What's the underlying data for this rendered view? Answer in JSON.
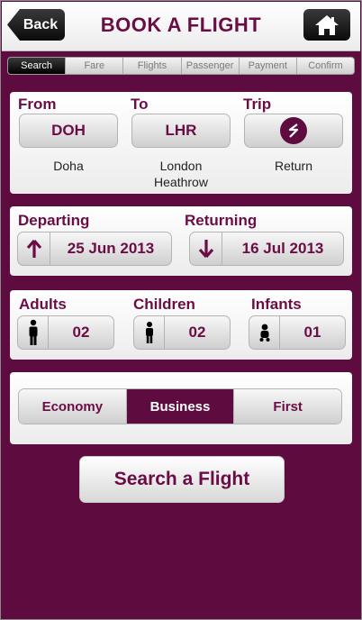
{
  "header": {
    "back_label": "Back",
    "title": "BOOK A FLIGHT",
    "home_icon": "home-icon"
  },
  "steps": [
    {
      "label": "Search",
      "active": true
    },
    {
      "label": "Fare",
      "active": false
    },
    {
      "label": "Flights",
      "active": false
    },
    {
      "label": "Passenger",
      "active": false
    },
    {
      "label": "Payment",
      "active": false
    },
    {
      "label": "Confirm",
      "active": false
    }
  ],
  "route": {
    "from_label": "From",
    "to_label": "To",
    "trip_label": "Trip",
    "from_code": "DOH",
    "from_city": "Doha",
    "to_code": "LHR",
    "to_city_line1": "London",
    "to_city_line2": "Heathrow",
    "trip_icon": "return-trip-icon",
    "trip_value": "Return"
  },
  "dates": {
    "departing_label": "Departing",
    "returning_label": "Returning",
    "departing_value": "25 Jun 2013",
    "returning_value": "16 Jul 2013"
  },
  "passengers": {
    "adults_label": "Adults",
    "children_label": "Children",
    "infants_label": "Infants",
    "adults_value": "02",
    "children_value": "02",
    "infants_value": "01"
  },
  "cabin": {
    "options": [
      "Economy",
      "Business",
      "First"
    ],
    "selected": "Business"
  },
  "search_button": "Search a Flight",
  "colors": {
    "brand": "#5e0b3f",
    "brand_text": "#6b0d45"
  }
}
